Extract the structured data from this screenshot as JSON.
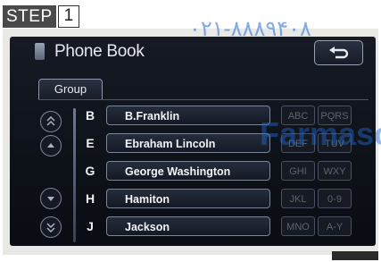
{
  "step": {
    "word": "STEP",
    "number": "1"
  },
  "screen": {
    "title": "Phone Book",
    "group_label": "Group",
    "rows": [
      {
        "letter": "B",
        "name": "B.Franklin"
      },
      {
        "letter": "E",
        "name": "Ebraham Lincoln"
      },
      {
        "letter": "G",
        "name": "George Washington"
      },
      {
        "letter": "H",
        "name": "Hamiton"
      },
      {
        "letter": "J",
        "name": "Jackson"
      }
    ],
    "groups": [
      "ABC",
      "PQRS",
      "DEF",
      "TUV",
      "GHI",
      "WXY",
      "JKL",
      "0-9",
      "MNO",
      "A-Y"
    ]
  },
  "watermark": {
    "phone": "۰۲۱-۸۸۸۹۴۰۸",
    "site": "Farmasc"
  },
  "colors": {
    "screen_bg": "#0d1118",
    "step_bg": "#4a4a4a",
    "watermark": "#1f6bd6"
  }
}
